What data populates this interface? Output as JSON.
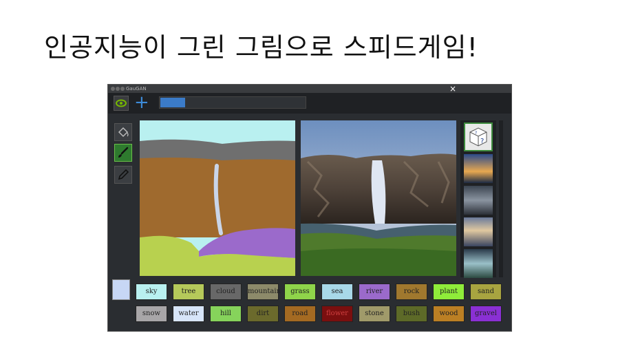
{
  "slide": {
    "title": "인공지능이 그린 그림으로 스피드게임!"
  },
  "window": {
    "title": "GauGAN",
    "close": "×"
  },
  "toolbar": {
    "add": "+",
    "progress_fraction": 0.17
  },
  "tools": [
    "paint-bucket-icon",
    "brush-icon",
    "pencil-icon"
  ],
  "thumbnails": [
    "random-dice",
    "sunset-sea",
    "stormy-sky",
    "cloudy-sunset",
    "wave-rock"
  ],
  "colors": {
    "selected_swatch": "#c7d7f5",
    "accent": "#3b7bc8"
  },
  "labels_row1": [
    {
      "name": "sky",
      "color": "#b9f0f0"
    },
    {
      "name": "tree",
      "color": "#b5c95a"
    },
    {
      "name": "cloud",
      "color": "#686868"
    },
    {
      "name": "mountain",
      "color": "#8d8a6a"
    },
    {
      "name": "grass",
      "color": "#8fd44a"
    },
    {
      "name": "sea",
      "color": "#a8d8e8"
    },
    {
      "name": "river",
      "color": "#9b6acb"
    },
    {
      "name": "rock",
      "color": "#a0782e"
    },
    {
      "name": "plant",
      "color": "#8fec3a"
    },
    {
      "name": "sand",
      "color": "#a8a440"
    }
  ],
  "labels_row2": [
    {
      "name": "snow",
      "color": "#a8a6a8"
    },
    {
      "name": "water",
      "color": "#d7e5f9"
    },
    {
      "name": "hill",
      "color": "#86d35b"
    },
    {
      "name": "dirt",
      "color": "#6b6a2c"
    },
    {
      "name": "road",
      "color": "#a46a22"
    },
    {
      "name": "flower",
      "color": "#7a0f0f"
    },
    {
      "name": "stone",
      "color": "#a09a6a"
    },
    {
      "name": "bush",
      "color": "#5d6a28"
    },
    {
      "name": "wood",
      "color": "#bb7f24"
    },
    {
      "name": "gravel",
      "color": "#8a30d4"
    }
  ]
}
